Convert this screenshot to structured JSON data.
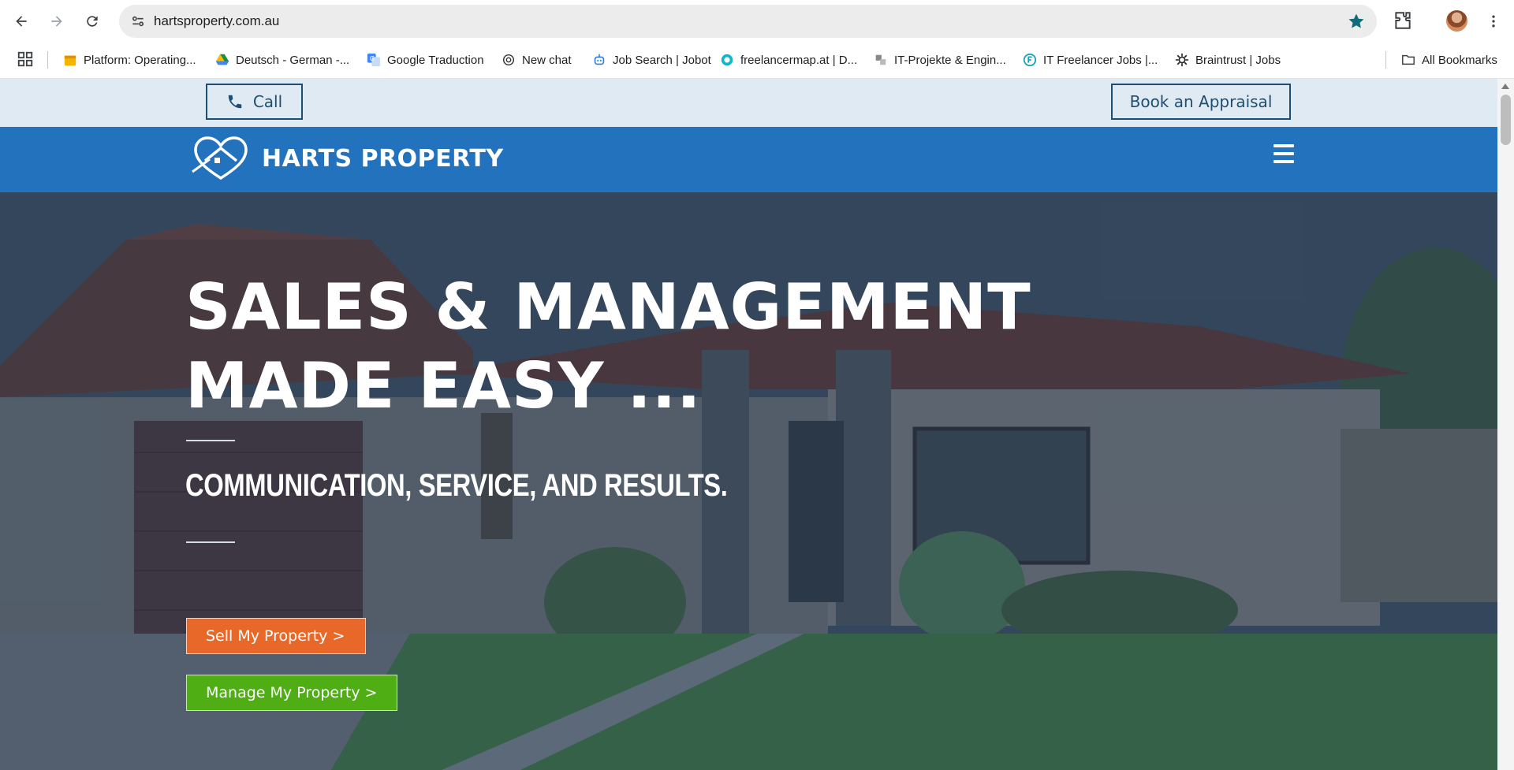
{
  "browser": {
    "url": "hartsproperty.com.au",
    "bookmarks": [
      {
        "label": "Platform: Operating...",
        "icon": "box-icon",
        "color": "#f4b400"
      },
      {
        "label": "Deutsch - German -...",
        "icon": "drive-icon",
        "color": "#1e8e3e"
      },
      {
        "label": "Google Traduction",
        "icon": "translate-icon",
        "color": "#4285f4"
      },
      {
        "label": "New chat",
        "icon": "openai-icon",
        "color": "#333333"
      },
      {
        "label": "Job Search | Jobot",
        "icon": "robot-icon",
        "color": "#2a7de1"
      },
      {
        "label": "freelancermap.at | D...",
        "icon": "freelancermap-icon",
        "color": "#10b6c9"
      },
      {
        "label": "IT-Projekte & Engin...",
        "icon": "it-icon",
        "color": "#777777"
      },
      {
        "label": "IT Freelancer Jobs |...",
        "icon": "freelancer-icon",
        "color": "#17a2b8"
      },
      {
        "label": "Braintrust | Jobs",
        "icon": "braintrust-icon",
        "color": "#222222"
      }
    ],
    "all_bookmarks_label": "All Bookmarks"
  },
  "page": {
    "topbar": {
      "call_label": "Call",
      "appraisal_label": "Book an Appraisal"
    },
    "header": {
      "logo_text": "HARTS PROPERTY"
    },
    "hero": {
      "headline_line1": "SALES & MANAGEMENT",
      "headline_line2": "MADE EASY ...",
      "subtitle": "COMMUNICATION, SERVICE, AND RESULTS.",
      "sell_label": "Sell My Property >",
      "manage_label": "Manage My Property >"
    }
  },
  "colors": {
    "header_blue": "#2272bd",
    "topbar_bg": "#dfeaf3",
    "sell_orange": "#e8682a",
    "manage_green": "#4fae14"
  }
}
